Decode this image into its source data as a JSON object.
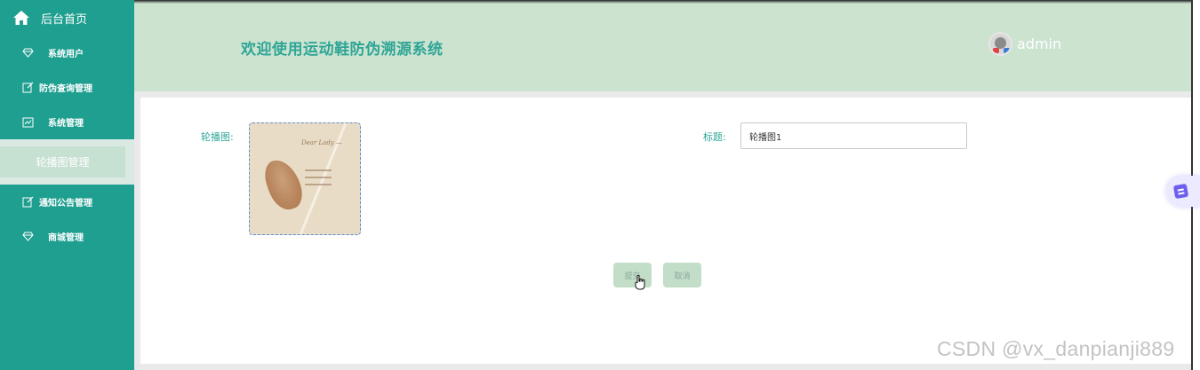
{
  "sidebar": {
    "home_label": "后台首页",
    "items": [
      {
        "label": "系统用户",
        "icon": "diamond-icon"
      },
      {
        "label": "防伪查询管理",
        "icon": "edit-icon"
      },
      {
        "label": "系统管理",
        "icon": "chart-icon"
      },
      {
        "label": "轮播图管理",
        "icon": "none",
        "active": true
      },
      {
        "label": "通知公告管理",
        "icon": "edit-icon"
      },
      {
        "label": "商城管理",
        "icon": "diamond-icon"
      }
    ]
  },
  "header": {
    "title": "欢迎使用运动鞋防伪溯源系统",
    "username": "admin"
  },
  "form": {
    "image_label": "轮播图:",
    "title_label": "标题:",
    "title_value": "轮播图1",
    "image_text": "Dear Lady —",
    "submit_label": "提交",
    "cancel_label": "取消"
  },
  "watermark": "CSDN @vx_danpianji889",
  "colors": {
    "sidebar": "#1f9f90",
    "header": "#cce3d0",
    "accent": "#2ea596",
    "button": "#c2ddc8"
  }
}
